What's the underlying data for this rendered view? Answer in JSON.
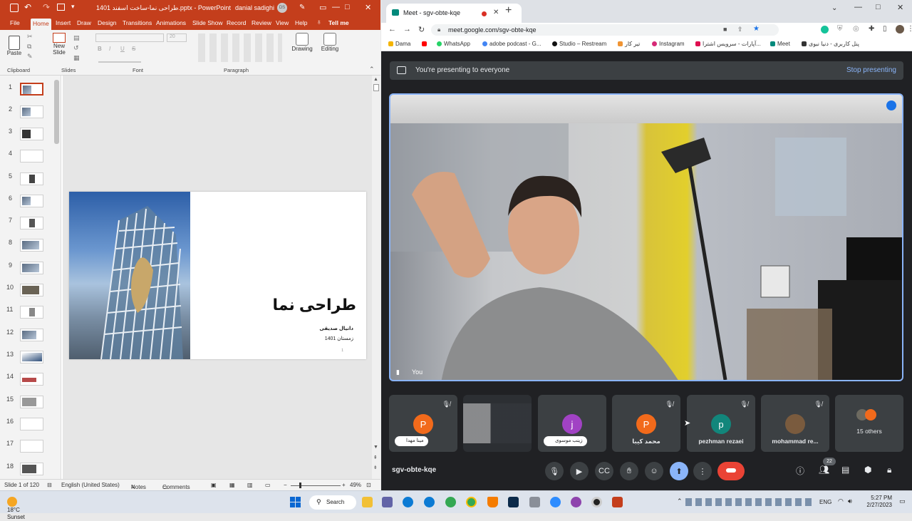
{
  "powerpoint": {
    "title": "طراحی نما-ساخت اسفند 1401.pptx - PowerPoint",
    "user": "danial sadighi",
    "user_initials": "DS",
    "tabs": [
      "File",
      "Home",
      "Insert",
      "Draw",
      "Design",
      "Transitions",
      "Animations",
      "Slide Show",
      "Record",
      "Review",
      "View",
      "Help",
      "Tell me"
    ],
    "ribbon": {
      "paste": "Paste",
      "new_slide": "New Slide",
      "drawing": "Drawing",
      "editing": "Editing",
      "font_size": "20",
      "groups": [
        "Clipboard",
        "Slides",
        "Font",
        "Paragraph"
      ],
      "font_buttons": [
        "B",
        "I",
        "U",
        "S"
      ]
    },
    "thumbnails": [
      "1",
      "2",
      "3",
      "4",
      "5",
      "6",
      "7",
      "8",
      "9",
      "10",
      "11",
      "12",
      "13",
      "14",
      "15",
      "16",
      "17",
      "18"
    ],
    "slide": {
      "title": "طراحی نما",
      "subtitle1": "دانیال صدیقی",
      "subtitle2": "زمستان 1401",
      "page_number": "1"
    },
    "status": {
      "slide_of": "Slide 1 of 120",
      "language": "English (United States)",
      "notes": "Notes",
      "comments": "Comments",
      "zoom": "49%"
    }
  },
  "chrome": {
    "tab_title": "Meet - sgv-obte-kqe",
    "url": "meet.google.com/sgv-obte-kqe",
    "bookmarks": [
      {
        "label": "Dama",
        "color": "#f4b400"
      },
      {
        "label": "",
        "color": "#ff0000"
      },
      {
        "label": "WhatsApp",
        "color": "#25d366"
      },
      {
        "label": "adobe podcast - G...",
        "color": "#4285f4"
      },
      {
        "label": "Studio – Restream",
        "color": "#111111"
      },
      {
        "label": "تیر کار",
        "color": "#f09433"
      },
      {
        "label": "Instagram",
        "color": "#d62976"
      },
      {
        "label": "آپارات - سرویس اشترا...",
        "color": "#df0f50"
      },
      {
        "label": "Meet",
        "color": "#00897b"
      },
      {
        "label": "پنل کاربری - دنیا نبوی",
        "color": "#333333"
      }
    ]
  },
  "meet": {
    "presenting_text": "You're presenting to everyone",
    "stop_presenting": "Stop presenting",
    "self_label": "You",
    "tiles": [
      {
        "type": "avatar",
        "initial": "P",
        "color": "#f26a1b",
        "name": "",
        "pill": "مینا مهدا",
        "muted": true
      },
      {
        "type": "screen",
        "name": "",
        "pill": "",
        "muted": false
      },
      {
        "type": "avatar",
        "initial": "j",
        "color": "#a142c4",
        "name": "",
        "pill": "زینب موسوی",
        "muted": false
      },
      {
        "type": "avatar",
        "initial": "P",
        "color": "#f26a1b",
        "name": "محمد کیبا",
        "pill": "",
        "muted": true
      },
      {
        "type": "avatar",
        "initial": "p",
        "color": "#12867b",
        "name": "pezhman rezaei",
        "pill": "",
        "muted": true
      },
      {
        "type": "photo",
        "initial": "",
        "color": "#7a5b3e",
        "name": "mohammad re...",
        "pill": "",
        "muted": true
      },
      {
        "type": "others",
        "initial": "",
        "color": "#f26a1b",
        "name": "15 others",
        "pill": "",
        "muted": false
      }
    ],
    "meeting_code": "sgv-obte-kqe",
    "people_count": "22"
  },
  "taskbar": {
    "weather_temp": "18°C",
    "weather_desc": "Sunset",
    "search": "Search",
    "lang": "ENG",
    "time": "5:27 PM",
    "date": "2/27/2023",
    "apps": [
      {
        "name": "file-explorer",
        "color": "#f2c037"
      },
      {
        "name": "teams",
        "color": "#6264a7"
      },
      {
        "name": "edge",
        "color": "#0c7bd4"
      },
      {
        "name": "chrome",
        "color": "#34a853"
      },
      {
        "name": "vlc",
        "color": "#f57c00"
      },
      {
        "name": "photoshop",
        "color": "#0b2a4a"
      },
      {
        "name": "app-gray",
        "color": "#8a8f98"
      },
      {
        "name": "zoom",
        "color": "#2d8cff"
      },
      {
        "name": "obs",
        "color": "#8e44ad"
      },
      {
        "name": "recorder",
        "color": "#222222"
      },
      {
        "name": "powerpoint",
        "color": "#c43e1c"
      }
    ]
  }
}
